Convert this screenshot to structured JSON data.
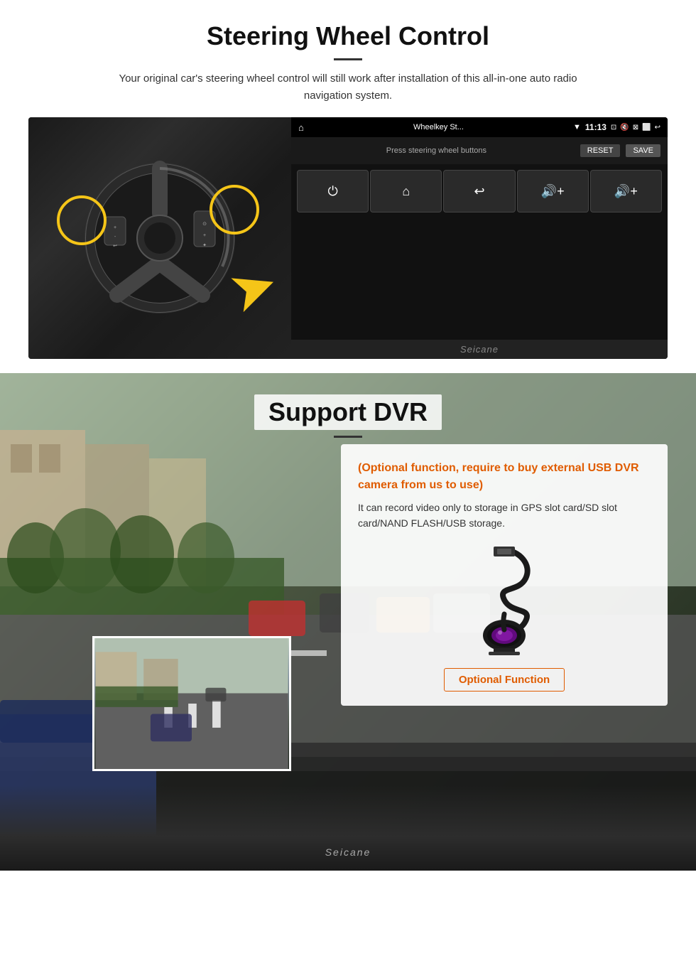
{
  "steering": {
    "title": "Steering Wheel Control",
    "description": "Your original car's steering wheel control will still work after installation of this all-in-one auto radio navigation system.",
    "headunit": {
      "app_name": "Wheelkey St...",
      "time": "11:13",
      "toolbar_label": "Press steering wheel buttons",
      "reset_btn": "RESET",
      "save_btn": "SAVE",
      "buttons": [
        "⏻",
        "⌂",
        "↩",
        "🔊+",
        "🔊+"
      ]
    },
    "seicane_label": "Seicane"
  },
  "dvr": {
    "title": "Support DVR",
    "optional_text": "(Optional function, require to buy external USB DVR camera from us to use)",
    "description": "It can record video only to storage in GPS slot card/SD slot card/NAND FLASH/USB storage.",
    "optional_function_label": "Optional Function",
    "seicane_label": "Seicane"
  }
}
